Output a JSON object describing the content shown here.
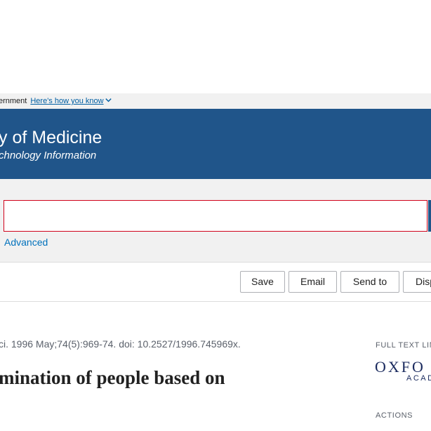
{
  "gov_banner": {
    "text": "ernment",
    "link": "Here's how you know",
    "chevron_icon": "chevron-down-icon"
  },
  "header": {
    "title": "y of Medicine",
    "subtitle": "chnology Information",
    "background_color": "#20558a"
  },
  "search": {
    "value": "",
    "placeholder": "",
    "advanced_label": "Advanced",
    "border_color": "#d0021b"
  },
  "actions": {
    "save": "Save",
    "email": "Email",
    "send_to": "Send to",
    "display": "Disp"
  },
  "article": {
    "citation": "ci. 1996 May;74(5):969-74. doi: 10.2527/1996.745969x.",
    "title": "mination of people based on"
  },
  "sidebar": {
    "full_text_links_label": "FULL TEXT LIN",
    "publisher_logo_main": "OXFO",
    "publisher_logo_sub": "ACAD",
    "actions_label": "ACTIONS"
  }
}
